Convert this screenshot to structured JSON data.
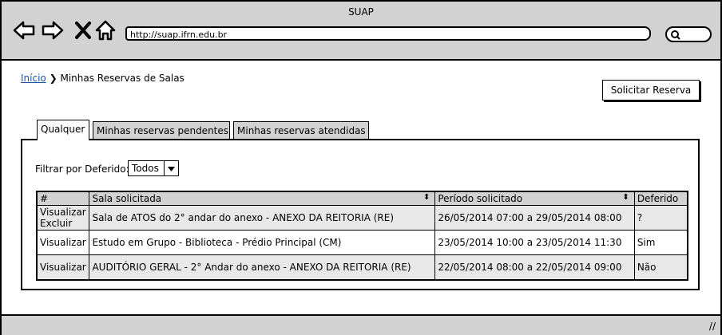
{
  "window": {
    "title": "SUAP"
  },
  "browser": {
    "url": "http://suap.ifrn.edu.br",
    "icons": [
      "back-arrow-icon",
      "forward-arrow-icon",
      "close-x-icon",
      "home-icon",
      "search-icon"
    ]
  },
  "breadcrumb": {
    "home": "Início",
    "separator": "❯",
    "current": "Minhas Reservas de Salas"
  },
  "actions": {
    "solicitar": "Solicitar Reserva"
  },
  "tabs": [
    "Qualquer",
    "Minhas reservas pendentes",
    "Minhas reservas atendidas"
  ],
  "filter": {
    "label": "Filtrar por Deferido:",
    "selected": "Todos"
  },
  "table": {
    "headers": [
      "#",
      "Sala solicitada",
      "Período solicitado",
      "Deferido"
    ],
    "rows": [
      {
        "actions": [
          "Visualizar",
          "Excluir"
        ],
        "sala": "Sala de ATOS do 2° andar do anexo - ANEXO DA REITORIA (RE)",
        "periodo": "26/05/2014 07:00 a 29/05/2014 08:00",
        "deferido": "?"
      },
      {
        "actions": [
          "Visualizar"
        ],
        "sala": "Estudo em Grupo - Biblioteca - Prédio Principal (CM)",
        "periodo": "23/05/2014 10:00 a 23/05/2014 11:30",
        "deferido": "Sim"
      },
      {
        "actions": [
          "Visualizar"
        ],
        "sala": "AUDITÓRIO GERAL - 2° Andar do anexo - ANEXO DA REITORIA (RE)",
        "periodo": "22/05/2014 08:00 a 22/05/2014 09:00",
        "deferido": "Não"
      }
    ]
  },
  "colors": {
    "chrome": "#d2d2d2",
    "link": "#2255aa"
  }
}
